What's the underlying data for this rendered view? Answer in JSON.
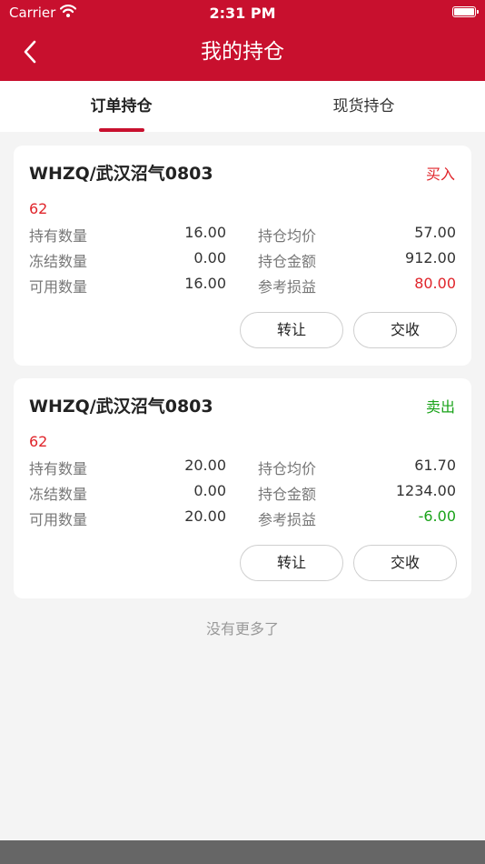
{
  "status_bar": {
    "carrier": "Carrier",
    "time": "2:31 PM"
  },
  "nav": {
    "title": "我的持仓"
  },
  "tabs": [
    {
      "label": "订单持仓",
      "active": true
    },
    {
      "label": "现货持仓",
      "active": false
    }
  ],
  "cards": [
    {
      "title": "WHZQ/武汉沼气0803",
      "side": "买入",
      "code": "62",
      "rows": [
        {
          "l1": "持有数量",
          "v1": "16.00",
          "l2": "持仓均价",
          "v2": "57.00"
        },
        {
          "l1": "冻结数量",
          "v1": "0.00",
          "l2": "持仓金额",
          "v2": "912.00"
        },
        {
          "l1": "可用数量",
          "v1": "16.00",
          "l2": "参考损益",
          "v2": "80.00"
        }
      ],
      "buttons": {
        "transfer": "转让",
        "deliver": "交收"
      }
    },
    {
      "title": "WHZQ/武汉沼气0803",
      "side": "卖出",
      "code": "62",
      "rows": [
        {
          "l1": "持有数量",
          "v1": "20.00",
          "l2": "持仓均价",
          "v2": "61.70"
        },
        {
          "l1": "冻结数量",
          "v1": "0.00",
          "l2": "持仓金额",
          "v2": "1234.00"
        },
        {
          "l1": "可用数量",
          "v1": "20.00",
          "l2": "参考损益",
          "v2": "-6.00"
        }
      ],
      "buttons": {
        "transfer": "转让",
        "deliver": "交收"
      }
    }
  ],
  "footer": {
    "no_more": "没有更多了"
  },
  "colors": {
    "brand": "#c8102e",
    "gain": "#e0252b",
    "loss": "#1aa31a"
  }
}
